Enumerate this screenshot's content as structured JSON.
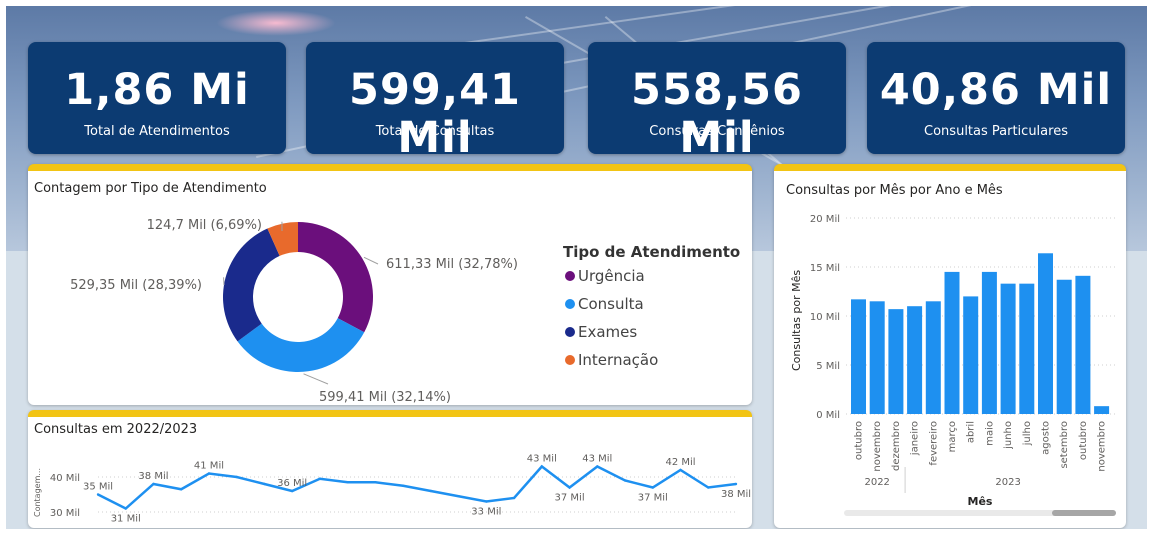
{
  "kpis": [
    {
      "value": "1,86 Mi",
      "label": "Total de Atendimentos"
    },
    {
      "value": "599,41 Mil",
      "label": "Total de Consultas"
    },
    {
      "value": "558,56 Mil",
      "label": "Consultas Convênios"
    },
    {
      "value": "40,86 Mil",
      "label": "Consultas Particulares"
    }
  ],
  "colors": {
    "kpi_bg": "#0c3b72",
    "card_accent": "#f2c414",
    "bar": "#1e90f0",
    "urgencia": "#6b0f7c",
    "consulta": "#1e90f0",
    "exames": "#1a2a8c",
    "internacao": "#e86a2c"
  },
  "chart_data": [
    {
      "type": "pie",
      "title": "Contagem por Tipo de Atendimento",
      "legend_title": "Tipo de Atendimento",
      "legend_position": "right",
      "categories": [
        "Urgência",
        "Consulta",
        "Exames",
        "Internação"
      ],
      "values": [
        611.33,
        599.41,
        529.35,
        124.7
      ],
      "data_labels": [
        "611,33 Mil (32,78%)",
        "599,41 Mil (32,14%)",
        "529,35 Mil (28,39%)",
        "124,7 Mil (6,69%)"
      ],
      "colors": [
        "#6b0f7c",
        "#1e90f0",
        "#1a2a8c",
        "#e86a2c"
      ]
    },
    {
      "type": "line",
      "title": "Consultas em 2022/2023",
      "ylabel": "Contagem...",
      "y_ticks": [
        "30 Mil",
        "40 Mil"
      ],
      "ylim": [
        28,
        44
      ],
      "values": [
        35,
        31,
        38,
        36.5,
        41,
        40,
        38,
        36,
        39.5,
        38.5,
        38.5,
        37.5,
        36,
        34.5,
        33,
        34,
        43,
        37,
        43,
        39,
        37,
        42,
        37,
        38
      ],
      "point_labels": [
        {
          "i": 0,
          "text": "35 Mil"
        },
        {
          "i": 1,
          "text": "31 Mil"
        },
        {
          "i": 2,
          "text": "38 Mil"
        },
        {
          "i": 4,
          "text": "41 Mil"
        },
        {
          "i": 7,
          "text": "36 Mil"
        },
        {
          "i": 14,
          "text": "33 Mil"
        },
        {
          "i": 16,
          "text": "43 Mil"
        },
        {
          "i": 17,
          "text": "37 Mil"
        },
        {
          "i": 18,
          "text": "43 Mil"
        },
        {
          "i": 20,
          "text": "37 Mil"
        },
        {
          "i": 21,
          "text": "42 Mil"
        },
        {
          "i": 23,
          "text": "38 Mil"
        }
      ]
    },
    {
      "type": "bar",
      "title": "Consultas por Mês por Ano e Mês",
      "xlabel": "Mês",
      "ylabel": "Consultas por Mês",
      "ylim": [
        0,
        20
      ],
      "y_ticks": [
        "0 Mil",
        "5 Mil",
        "10 Mil",
        "15 Mil",
        "20 Mil"
      ],
      "categories": [
        "outubro",
        "novembro",
        "dezembro",
        "janeiro",
        "fevereiro",
        "março",
        "abril",
        "maio",
        "junho",
        "julho",
        "agosto",
        "setembro",
        "outubro",
        "novembro"
      ],
      "years": [
        {
          "label": "2022",
          "from": 0,
          "to": 2
        },
        {
          "label": "2023",
          "from": 3,
          "to": 13
        }
      ],
      "values": [
        11.7,
        11.5,
        10.7,
        11.0,
        11.5,
        14.5,
        12.0,
        14.5,
        13.3,
        13.3,
        16.4,
        13.7,
        14.1,
        0.8
      ]
    }
  ]
}
